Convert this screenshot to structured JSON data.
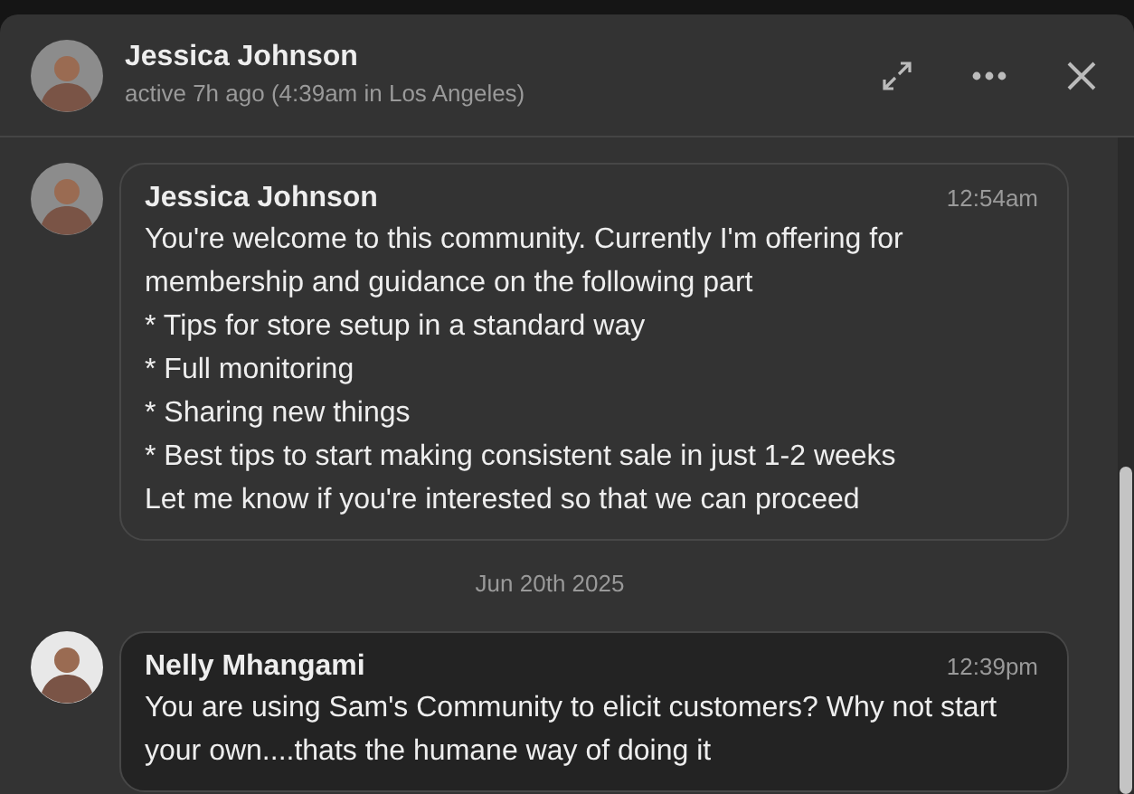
{
  "header": {
    "name": "Jessica Johnson",
    "status": "active 7h ago (4:39am in Los Angeles)"
  },
  "messages": [
    {
      "kind": "message",
      "author": "Jessica Johnson",
      "time": "12:54am",
      "highlighted": false,
      "lines": [
        "You're welcome to this community. Currently I'm offering for membership and guidance on the following part",
        "* Tips for store setup in a standard way",
        "* Full monitoring",
        "* Sharing new things",
        "* Best tips to start making consistent sale in just 1-2 weeks",
        "Let me know if you're interested so that we can proceed"
      ]
    },
    {
      "kind": "date",
      "text": "Jun 20th 2025"
    },
    {
      "kind": "message",
      "author": "Nelly Mhangami",
      "time": "12:39pm",
      "highlighted": true,
      "lines": [
        "You are using Sam's Community to elicit customers? Why not start your own....thats the humane way of doing it"
      ]
    }
  ]
}
